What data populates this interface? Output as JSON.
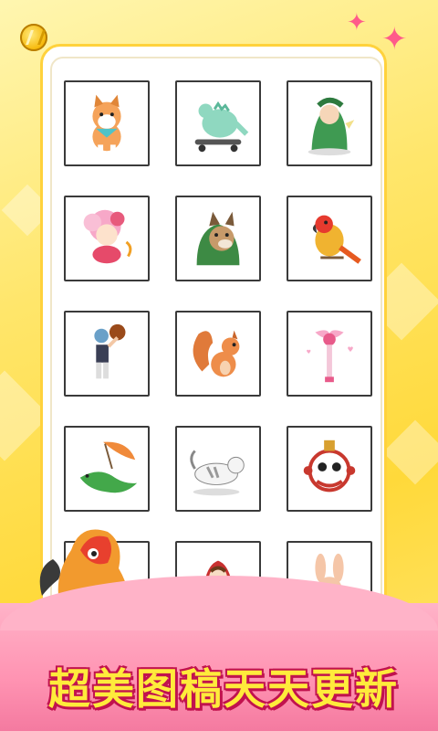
{
  "header": {
    "coin_icon": "coin-icon"
  },
  "gallery": {
    "tiles": [
      {
        "name": "shiba-dog",
        "icon": "shiba-icon"
      },
      {
        "name": "dinosaur-skateboard",
        "icon": "dino-skate-icon"
      },
      {
        "name": "dino-costume-kid",
        "icon": "dino-costume-icon"
      },
      {
        "name": "pink-hair-girl",
        "icon": "girl-icon"
      },
      {
        "name": "bulldog-dino-hood",
        "icon": "bulldog-icon"
      },
      {
        "name": "parrot",
        "icon": "parrot-icon"
      },
      {
        "name": "basketball-player",
        "icon": "player-icon"
      },
      {
        "name": "squirrel",
        "icon": "squirrel-icon"
      },
      {
        "name": "magic-wand",
        "icon": "wand-icon"
      },
      {
        "name": "crocodile-leaf-umbrella",
        "icon": "crocodile-icon"
      },
      {
        "name": "cat",
        "icon": "cat-icon"
      },
      {
        "name": "lion-dance",
        "icon": "lion-dance-icon"
      },
      {
        "name": "blank",
        "icon": ""
      },
      {
        "name": "red-hood-girl",
        "icon": "red-hood-icon"
      },
      {
        "name": "bunny",
        "icon": "bunny-icon"
      }
    ]
  },
  "banner": {
    "slogan": "超美图稿天天更新"
  },
  "colors": {
    "accent": "#ffd23c",
    "banner": "#ff93b2",
    "slogan": "#ffeb3b",
    "slogan_stroke": "#c1124e"
  }
}
